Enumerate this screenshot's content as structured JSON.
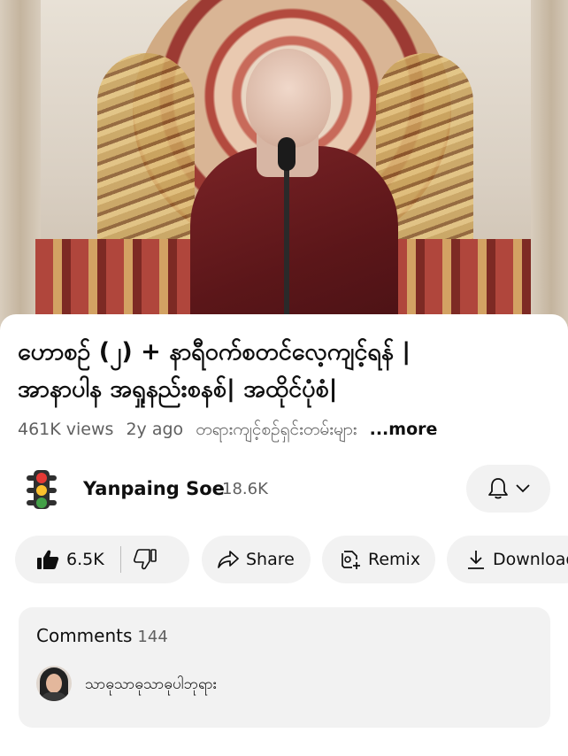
{
  "video": {
    "title_line1": "ဟောစဉ် (၂) + နာရီဝက်စတင်လေ့ကျင့်ရန် |",
    "title_line2": "အာနာပါန အရှုနည်းစနစ်| အထိုင်ပုံစံ|",
    "views": "461K views",
    "age": "2y ago",
    "hashtag": "တရားကျင့်စဉ်ရှင်းတမ်းများ",
    "more_label": "...more"
  },
  "channel": {
    "name": "Yanpaing Soe",
    "subscribers": "18.6K",
    "avatar_icon": "traffic-light-icon"
  },
  "actions": {
    "like_count": "6.5K",
    "share_label": "Share",
    "remix_label": "Remix",
    "download_label": "Download"
  },
  "comments": {
    "label": "Comments",
    "count": "144",
    "top_comment": "သာဓုသာဓုသာဓုပါဘုရား"
  },
  "colors": {
    "chip_bg": "#f2f2f2",
    "secondary_text": "#606060",
    "primary_text": "#0f0f0f",
    "robe": "#5b1619"
  }
}
